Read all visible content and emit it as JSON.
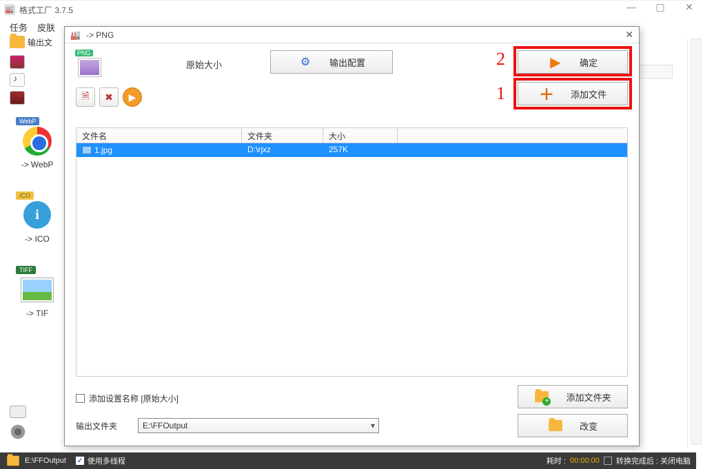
{
  "app": {
    "title": "格式工厂 3.7.5"
  },
  "window_controls": {
    "min": "—",
    "max": "▢",
    "close": "✕"
  },
  "menubar": [
    "任务",
    "皮肤"
  ],
  "left": {
    "output_btn": "输出文",
    "cards": [
      {
        "badge": "WebP",
        "label": "-> WebP"
      },
      {
        "badge": "ICO",
        "label": "-> ICO"
      },
      {
        "badge": "TIFF",
        "label": "-> TIF"
      }
    ]
  },
  "dialog": {
    "title": "  -> PNG",
    "png_badge": "PNG",
    "orig_size": "原始大小",
    "buttons": {
      "output_cfg": "输出配置",
      "ok": "确定",
      "add_file": "添加文件",
      "add_folder": "添加文件夹",
      "change": "改变"
    },
    "annotations": {
      "one": "1",
      "two": "2"
    },
    "filelist": {
      "headers": {
        "name": "文件名",
        "folder": "文件夹",
        "size": "大小"
      },
      "rows": [
        {
          "name": "1.jpg",
          "folder": "D:\\rjxz",
          "size": "257K"
        }
      ]
    },
    "checkbox_label": "添加设置名称 [原始大小]",
    "output_folder_label": "输出文件夹",
    "output_folder_value": "E:\\FFOutput"
  },
  "statusbar": {
    "path": "E:\\FFOutput",
    "multithread": "使用多线程",
    "elapsed_label": "耗时 :",
    "elapsed_time": "00:00:00",
    "shutdown": "转换完成后 : 关闭电脑"
  }
}
